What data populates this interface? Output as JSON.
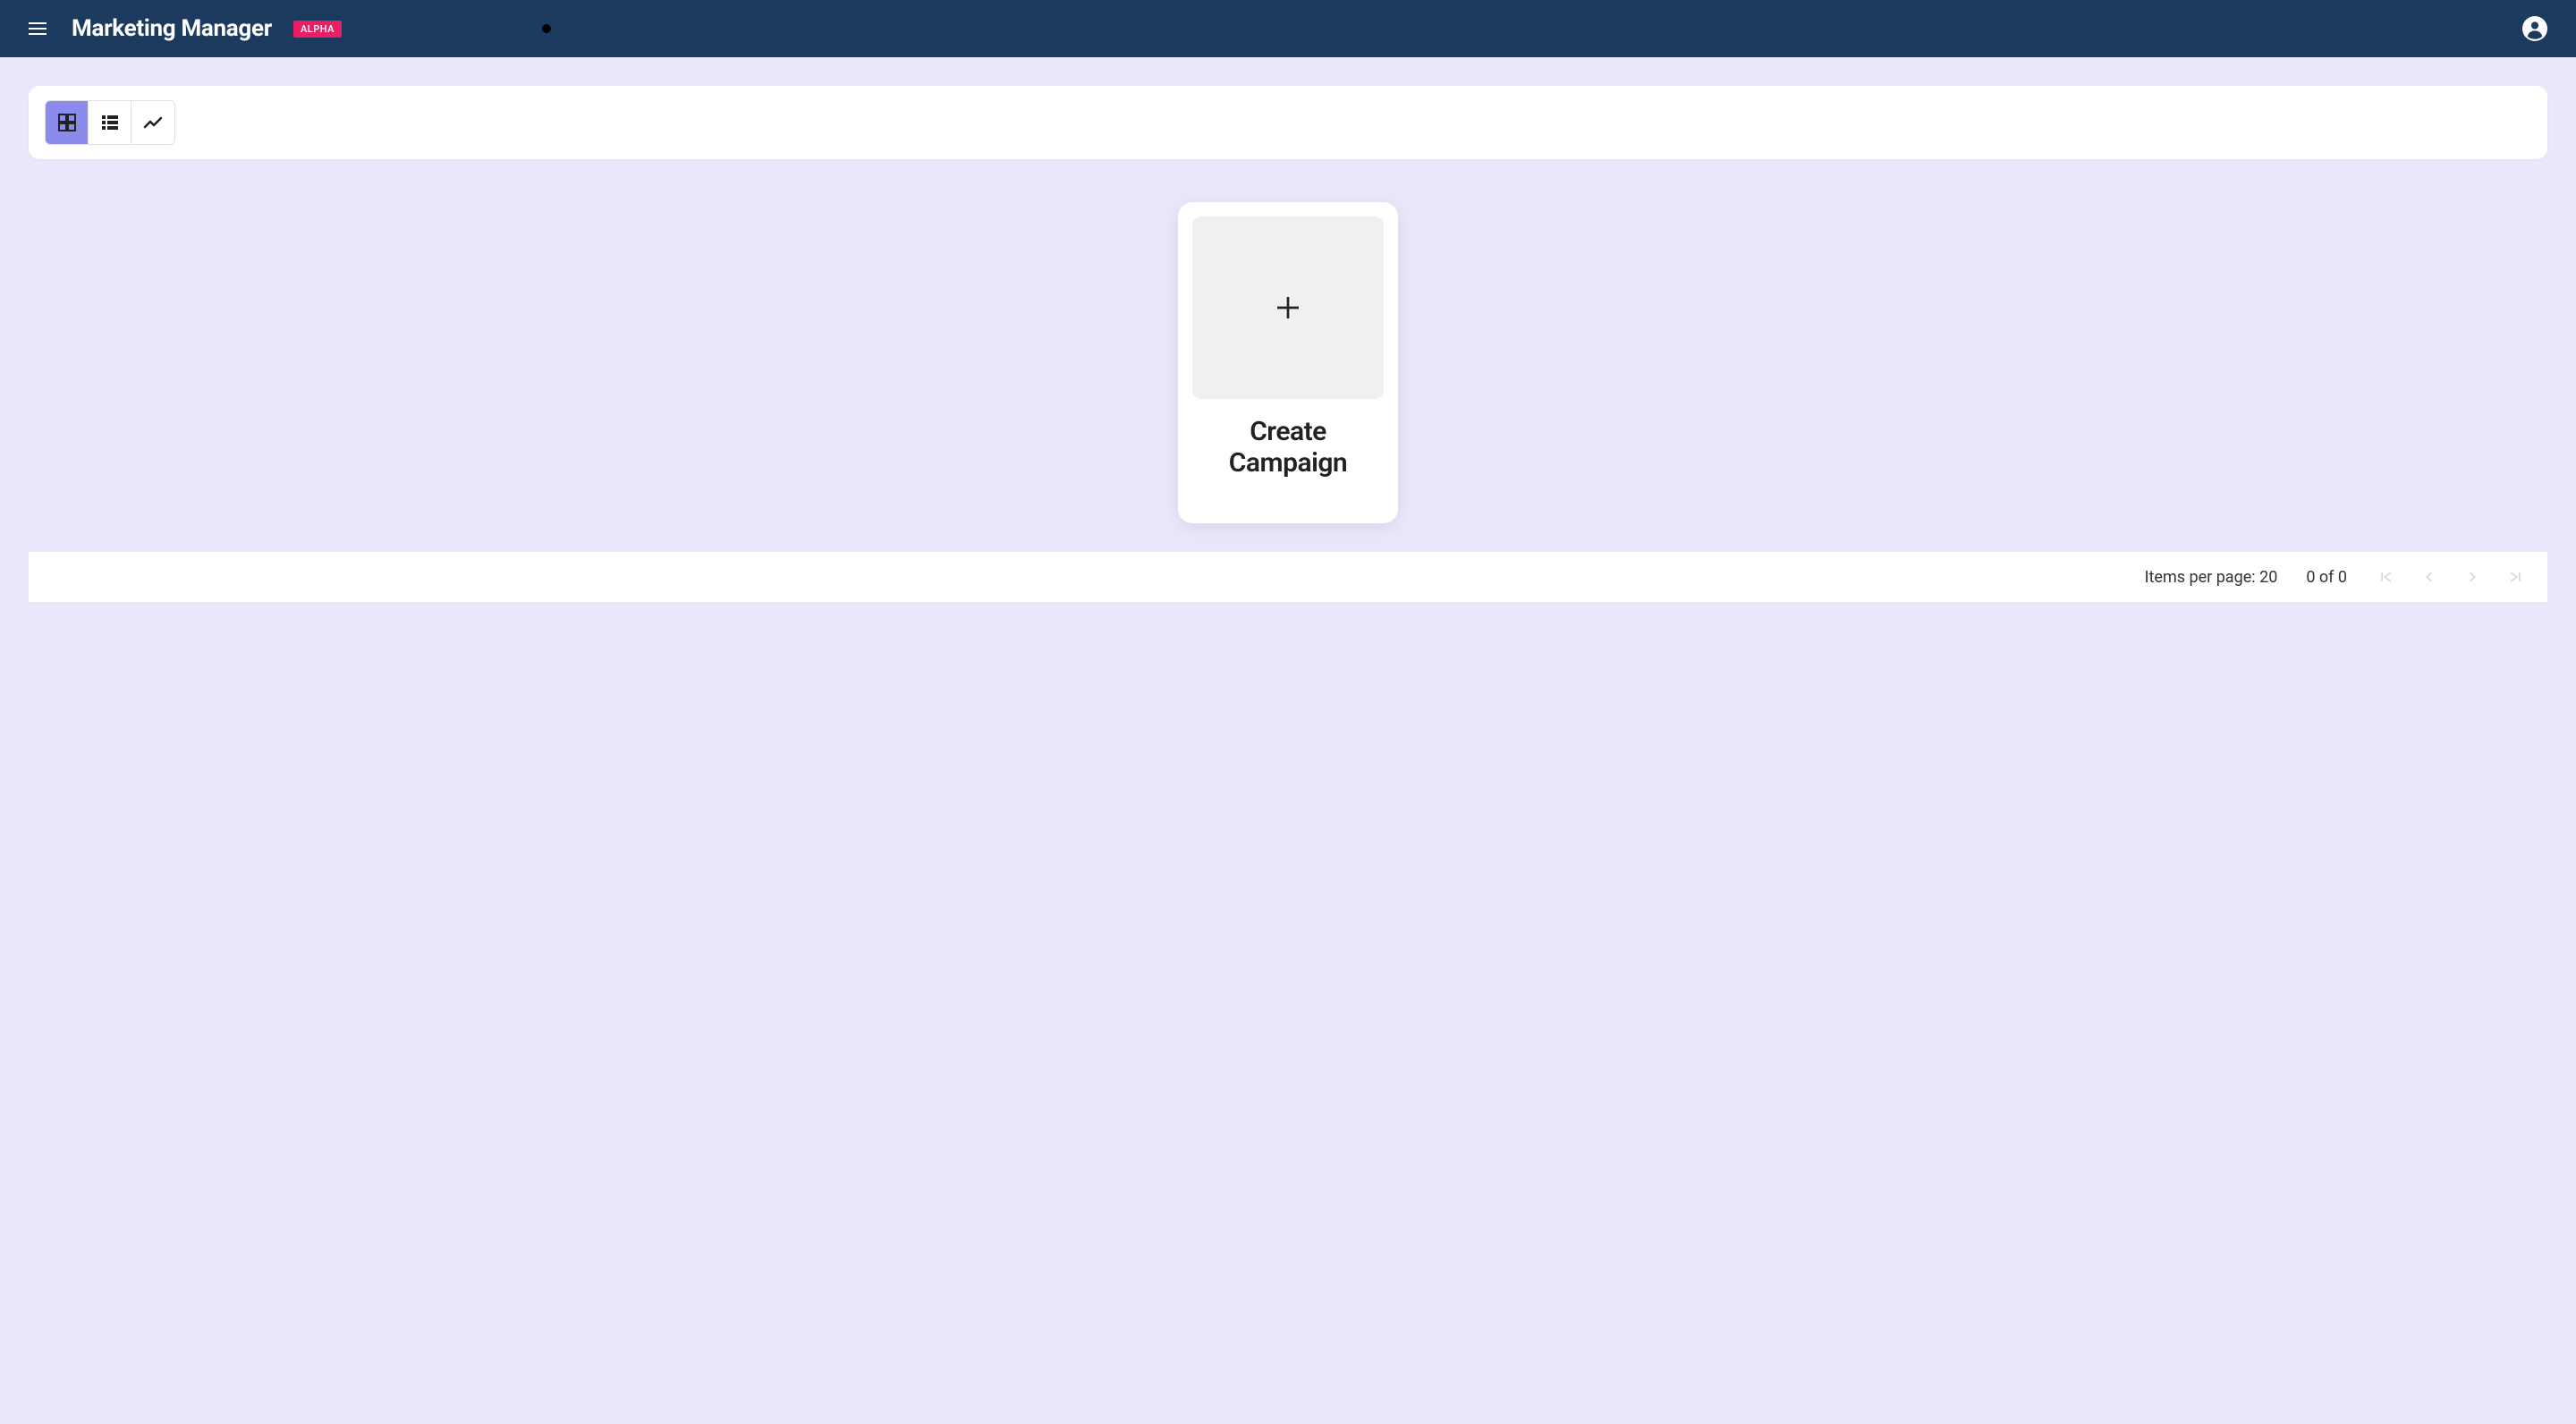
{
  "header": {
    "title": "Marketing Manager",
    "badge": "ALPHA"
  },
  "viewModes": {
    "grid": "grid-view",
    "list": "list-view",
    "chart": "chart-view"
  },
  "createCard": {
    "label": "Create Campaign"
  },
  "pagination": {
    "itemsPerPageLabel": "Items per page:",
    "itemsPerPageValue": "20",
    "rangeText": "0 of 0"
  }
}
